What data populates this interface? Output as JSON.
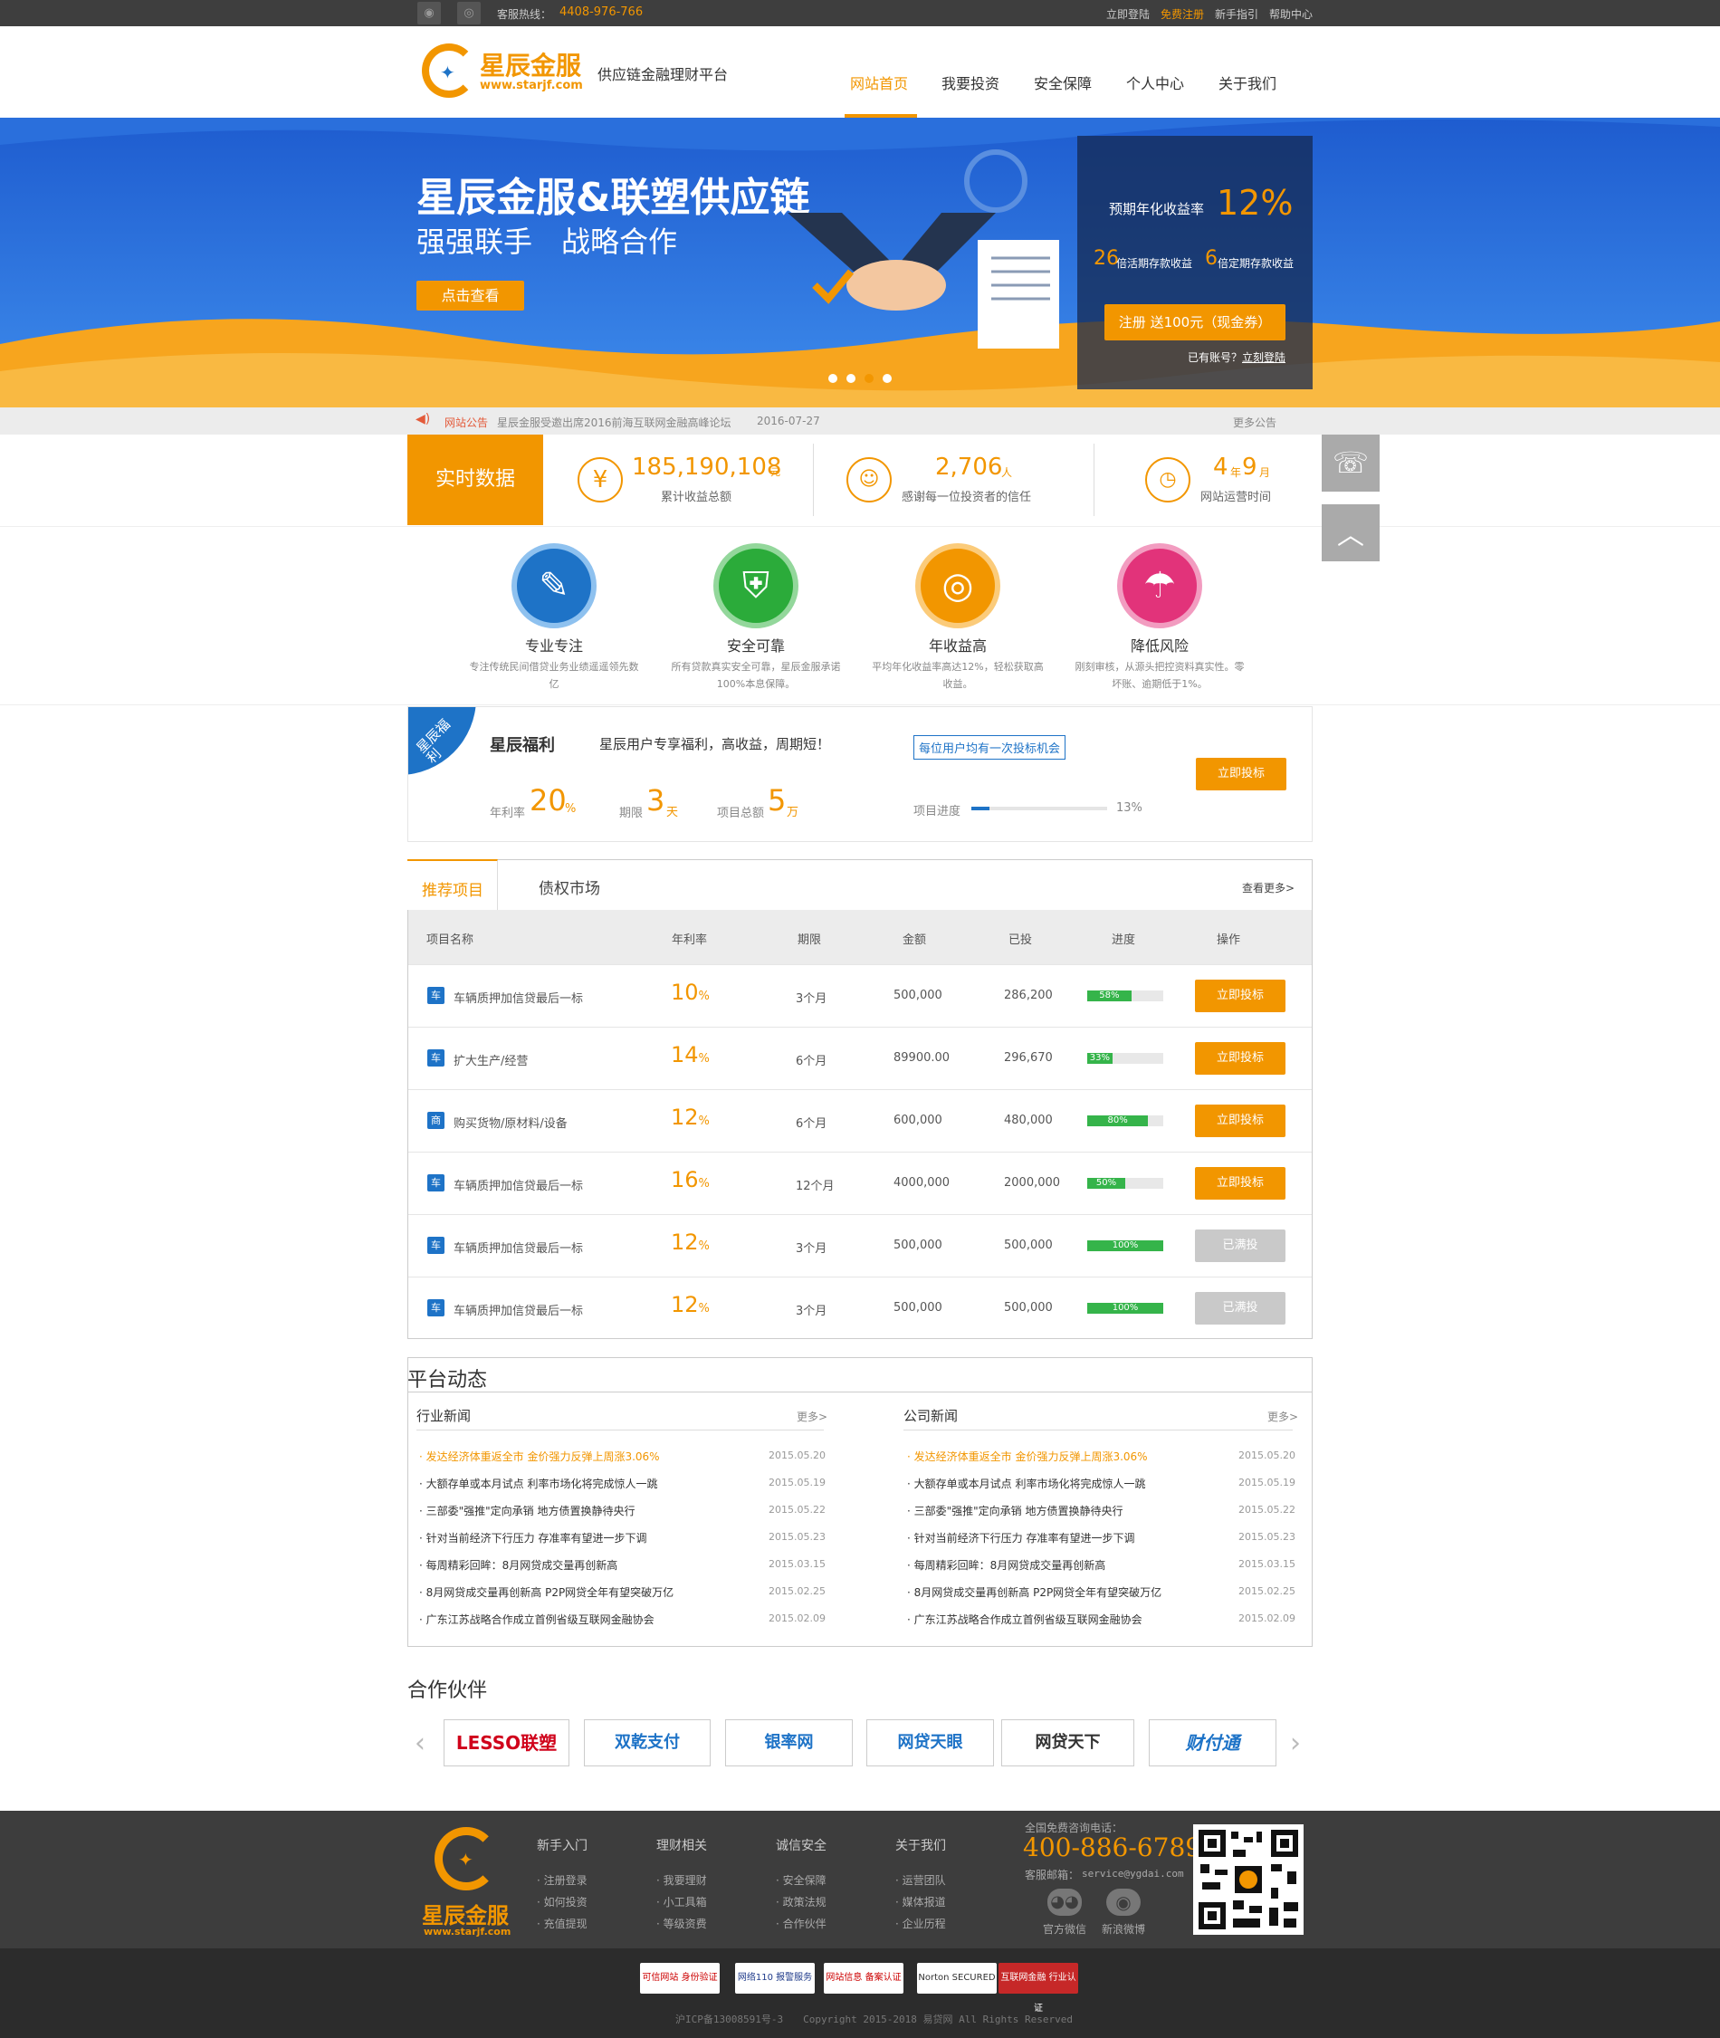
{
  "topbar": {
    "hotline_label": "客服热线：",
    "hotline": "4408-976-766",
    "links": [
      "立即登陆",
      "免费注册",
      "新手指引",
      "帮助中心"
    ]
  },
  "brand": {
    "name": "星辰金服",
    "url": "www.starjf.com",
    "slogan": "供应链金融理财平台"
  },
  "nav": [
    "网站首页",
    "我要投资",
    "安全保障",
    "个人中心",
    "关于我们"
  ],
  "banner": {
    "title": "星辰金服&联塑供应链",
    "subtitle": "强强联手　战略合作",
    "cta": "点击查看",
    "panel": {
      "rate_label": "预期年化收益率",
      "rate": "12%",
      "mult1": "26",
      "mult1_label": "倍活期存款收益",
      "mult2": "6",
      "mult2_label": "倍定期存款收益",
      "register": "注册 送100元（现金券）",
      "has_account": "已有账号？",
      "login": "立刻登陆"
    }
  },
  "notice": {
    "label": "网站公告",
    "text": "星辰金服受邀出席2016前海互联网金融高峰论坛",
    "date": "2016-07-27",
    "more": "更多公告"
  },
  "stats": {
    "label": "实时数据",
    "items": [
      {
        "icon": "yen-icon",
        "value": "185,190,108",
        "unit": "元",
        "desc": "累计收益总额"
      },
      {
        "icon": "users-icon",
        "value": "2,706",
        "unit": "人",
        "desc": "感谢每一位投资者的信任"
      },
      {
        "icon": "clock-icon",
        "value1": "4",
        "unit1": "年",
        "value2": "9",
        "unit2": "月",
        "desc": "网站运营时间"
      }
    ]
  },
  "features": [
    {
      "title": "专业专注",
      "desc": "专注传统民间借贷业务业绩遥遥领先数亿",
      "color": "#1e73c7"
    },
    {
      "title": "安全可靠",
      "desc": "所有贷款真实安全可靠，星辰金服承诺100%本息保障。",
      "color": "#2bab3a"
    },
    {
      "title": "年收益高",
      "desc": "平均年化收益率高达12%，轻松获取高收益。",
      "color": "#f29600"
    },
    {
      "title": "降低风险",
      "desc": "刚刻审核，从源头把控资料真实性。零坏账、逾期低于1%。",
      "color": "#e2337a"
    }
  ],
  "welfare": {
    "ribbon": "星辰福利",
    "title": "星辰福利",
    "desc": "星辰用户专享福利，高收益，周期短！",
    "tip": "每位用户均有一次投标机会",
    "rate_label": "年利率",
    "rate": "20",
    "rate_unit": "%",
    "term_label": "期限",
    "term": "3",
    "term_unit": "天",
    "total_label": "项目总额",
    "total": "5",
    "total_unit": "万",
    "progress_label": "项目进度",
    "progress": "13%",
    "progress_value": 0.13,
    "button": "立即投标"
  },
  "projects": {
    "tabs": [
      "推荐项目",
      "债权市场"
    ],
    "more": "查看更多>",
    "headers": [
      "项目名称",
      "年利率",
      "期限",
      "金额",
      "已投",
      "进度",
      "操作"
    ],
    "rows": [
      {
        "tag": "车",
        "name": "车辆质押加信贷最后一标",
        "rate": "10",
        "term": "3个月",
        "amount": "500,000",
        "invested": "286,200",
        "progress": "58%",
        "pv": 0.58,
        "action": "立即投标",
        "done": false
      },
      {
        "tag": "车",
        "name": "扩大生产/经营",
        "rate": "14",
        "term": "6个月",
        "amount": "89900.00",
        "invested": "296,670",
        "progress": "33%",
        "pv": 0.33,
        "action": "立即投标",
        "done": false
      },
      {
        "tag": "商",
        "name": "购买货物/原材料/设备",
        "rate": "12",
        "term": "6个月",
        "amount": "600,000",
        "invested": "480,000",
        "progress": "80%",
        "pv": 0.8,
        "action": "立即投标",
        "done": false
      },
      {
        "tag": "车",
        "name": "车辆质押加信贷最后一标",
        "rate": "16",
        "term": "12个月",
        "amount": "4000,000",
        "invested": "2000,000",
        "progress": "50%",
        "pv": 0.5,
        "action": "立即投标",
        "done": false
      },
      {
        "tag": "车",
        "name": "车辆质押加信贷最后一标",
        "rate": "12",
        "term": "3个月",
        "amount": "500,000",
        "invested": "500,000",
        "progress": "100%",
        "pv": 1,
        "action": "已满投",
        "done": true
      },
      {
        "tag": "车",
        "name": "车辆质押加信贷最后一标",
        "rate": "12",
        "term": "3个月",
        "amount": "500,000",
        "invested": "500,000",
        "progress": "100%",
        "pv": 1,
        "action": "已满投",
        "done": true
      }
    ]
  },
  "news": {
    "title": "平台动态",
    "more": "更多>",
    "industry_title": "行业新闻",
    "company_title": "公司新闻",
    "items": [
      {
        "t": "· 发达经济体重返全市 金价强力反弹上周涨3.06%",
        "d": "2015.05.20"
      },
      {
        "t": "· 大额存单或本月试点 利率市场化将完成惊人一跳",
        "d": "2015.05.19"
      },
      {
        "t": "· 三部委\"强推\"定向承销 地方债置换静待央行",
        "d": "2015.05.22"
      },
      {
        "t": "· 针对当前经济下行压力 存准率有望进一步下调",
        "d": "2015.05.23"
      },
      {
        "t": "· 每周精彩回眸：8月网贷成交量再创新高",
        "d": "2015.03.15"
      },
      {
        "t": "· 8月网贷成交量再创新高 P2P网贷全年有望突破万亿",
        "d": "2015.02.25"
      },
      {
        "t": "· 广东江苏战略合作成立首例省级互联网金融协会",
        "d": "2015.02.09"
      }
    ]
  },
  "partners": {
    "title": "合作伙伴",
    "list": [
      "LESSO联塑",
      "双乾支付",
      "银率网",
      "网贷天眼",
      "网贷天下",
      "财付通"
    ]
  },
  "footer": {
    "cols": [
      {
        "h": "新手入门",
        "l": [
          "· 注册登录",
          "· 如何投资",
          "· 充值提现"
        ]
      },
      {
        "h": "理财相关",
        "l": [
          "· 我要理财",
          "· 小工具箱",
          "· 等级资费"
        ]
      },
      {
        "h": "诚信安全",
        "l": [
          "· 安全保障",
          "· 政策法规",
          "· 合作伙伴"
        ]
      },
      {
        "h": "关于我们",
        "l": [
          "· 运营团队",
          "· 媒体报道",
          "· 企业历程"
        ]
      }
    ],
    "phone_label": "全国免费咨询电话：",
    "phone": "400-886-6789",
    "email_label": "客服邮箱：",
    "email": "service@ygdai.com",
    "wechat": "官方微信",
    "weibo": "新浪微博",
    "badges": [
      "可信网站 身份验证",
      "网络110 报警服务",
      "网站信息 备案认证",
      "Norton SECURED",
      "互联网金融 行业认证"
    ],
    "copyright": "沪ICP备13008591号-3　　Copyright 2015-2018 易贷网 All Rights Reserved"
  }
}
